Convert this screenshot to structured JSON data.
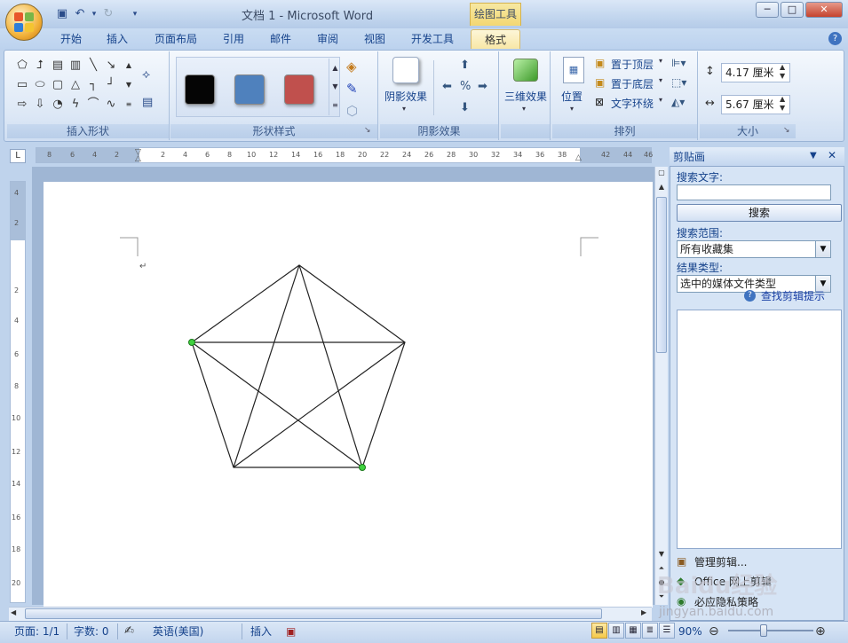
{
  "window": {
    "title": "文档 1 - Microsoft Word",
    "context_tool_label": "绘图工具",
    "controls": [
      "─",
      "□",
      "✕"
    ]
  },
  "tabs": [
    {
      "label": "开始"
    },
    {
      "label": "插入"
    },
    {
      "label": "页面布局"
    },
    {
      "label": "引用"
    },
    {
      "label": "邮件"
    },
    {
      "label": "审阅"
    },
    {
      "label": "视图"
    },
    {
      "label": "开发工具"
    },
    {
      "label": "格式"
    }
  ],
  "ribbon": {
    "groups": {
      "insert_shapes": "插入形状",
      "shape_styles": "形状样式",
      "shadow_effects": "阴影效果",
      "threed": "",
      "arrange": "排列",
      "size": "大小"
    },
    "swatch_colors": [
      "#050505",
      "#4f81bd",
      "#c0504d"
    ],
    "shadow_button": "阴影效果",
    "threed_button": "三维效果",
    "position_button": "位置",
    "bring_to_front": "置于顶层",
    "send_to_back": "置于底层",
    "text_wrap": "文字环绕",
    "height_value": "4.17 厘米",
    "width_value": "5.67 厘米"
  },
  "rulers": {
    "corner": "L",
    "h_ticks": [
      "8",
      "6",
      "4",
      "2",
      "2",
      "4",
      "6",
      "8",
      "10",
      "12",
      "14",
      "16",
      "18",
      "20",
      "22",
      "24",
      "26",
      "28",
      "30",
      "32",
      "34",
      "36",
      "38",
      "42",
      "44",
      "46"
    ],
    "v_ticks": [
      "4",
      "2",
      "2",
      "4",
      "6",
      "8",
      "10",
      "12",
      "14",
      "16",
      "18",
      "20"
    ]
  },
  "document": {
    "paragraph_mark": "↵"
  },
  "taskpane": {
    "title": "剪贴画",
    "search_text_label": "搜索文字:",
    "search_text_value": "",
    "search_button": "搜索",
    "search_scope_label": "搜索范围:",
    "search_scope_value": "所有收藏集",
    "result_type_label": "结果类型:",
    "result_type_value": "选中的媒体文件类型",
    "tips_link": "查找剪辑提示",
    "links": [
      "管理剪辑...",
      "Office 网上剪辑",
      "必应隐私策略"
    ]
  },
  "statusbar": {
    "page": "页面: 1/1",
    "words": "字数: 0",
    "language": "英语(美国)",
    "mode": "插入",
    "zoom": "90%"
  },
  "watermark": {
    "text": "Baidu经验",
    "sub": "jingyan.baidu.com"
  }
}
